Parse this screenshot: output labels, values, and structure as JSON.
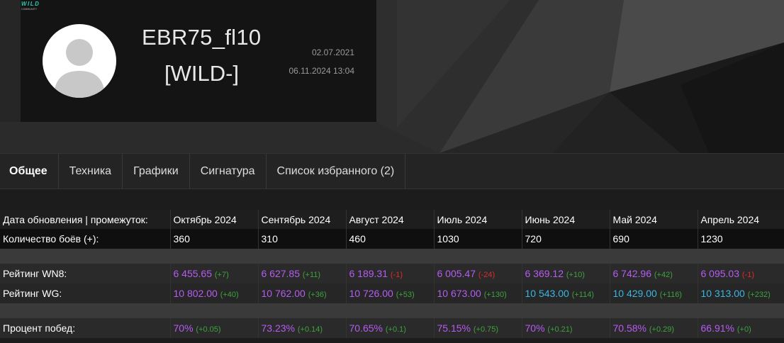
{
  "profile": {
    "nickname": "EBR75_fl10",
    "clan_tag": "[WILD-]",
    "clan_logo_text": "WILD",
    "clan_logo_sub": "COMMUNITY",
    "date_registered": "02.07.2021",
    "date_last_battle": "06.11.2024 13:04"
  },
  "tabs": [
    {
      "label": "Общее",
      "active": true
    },
    {
      "label": "Техника"
    },
    {
      "label": "Графики"
    },
    {
      "label": "Сигнатура"
    },
    {
      "label": "Список избранного (2)"
    }
  ],
  "table": {
    "header_label": "Дата обновления | промежуток:",
    "months": [
      "Октябрь 2024",
      "Сентябрь 2024",
      "Август 2024",
      "Июль 2024",
      "Июнь 2024",
      "Май 2024",
      "Апрель 2024"
    ],
    "battles_label": "Количество боёв (+):",
    "battles": [
      "360",
      "310",
      "460",
      "1030",
      "720",
      "690",
      "1230"
    ],
    "wn8_label": "Рейтинг WN8:",
    "wn8": [
      {
        "value": "6 455.65",
        "delta": "(+7)",
        "trend": "up",
        "tone": "purple"
      },
      {
        "value": "6 627.85",
        "delta": "(+11)",
        "trend": "up",
        "tone": "purple"
      },
      {
        "value": "6 189.31",
        "delta": "(-1)",
        "trend": "down",
        "tone": "purple"
      },
      {
        "value": "6 005.47",
        "delta": "(-24)",
        "trend": "down",
        "tone": "purple"
      },
      {
        "value": "6 369.12",
        "delta": "(+10)",
        "trend": "up",
        "tone": "purple"
      },
      {
        "value": "6 742.96",
        "delta": "(+42)",
        "trend": "up",
        "tone": "purple"
      },
      {
        "value": "6 095.03",
        "delta": "(-1)",
        "trend": "down",
        "tone": "purple"
      }
    ],
    "wg_label": "Рейтинг WG:",
    "wg": [
      {
        "value": "10 802.00",
        "delta": "(+40)",
        "trend": "up",
        "tone": "purple"
      },
      {
        "value": "10 762.00",
        "delta": "(+36)",
        "trend": "up",
        "tone": "purple"
      },
      {
        "value": "10 726.00",
        "delta": "(+53)",
        "trend": "up",
        "tone": "purple"
      },
      {
        "value": "10 673.00",
        "delta": "(+130)",
        "trend": "up",
        "tone": "purple"
      },
      {
        "value": "10 543.00",
        "delta": "(+114)",
        "trend": "up",
        "tone": "cyan"
      },
      {
        "value": "10 429.00",
        "delta": "(+116)",
        "trend": "up",
        "tone": "cyan"
      },
      {
        "value": "10 313.00",
        "delta": "(+232)",
        "trend": "up",
        "tone": "cyan"
      }
    ],
    "winrate_label": "Процент побед:",
    "winrate": [
      {
        "value": "70%",
        "delta": "(+0.05)",
        "trend": "up",
        "tone": "purple"
      },
      {
        "value": "73.23%",
        "delta": "(+0.14)",
        "trend": "up",
        "tone": "purple"
      },
      {
        "value": "70.65%",
        "delta": "(+0.1)",
        "trend": "up",
        "tone": "purple"
      },
      {
        "value": "75.15%",
        "delta": "(+0.75)",
        "trend": "up",
        "tone": "purple"
      },
      {
        "value": "70%",
        "delta": "(+0.21)",
        "trend": "up",
        "tone": "purple"
      },
      {
        "value": "70.58%",
        "delta": "(+0.29)",
        "trend": "up",
        "tone": "purple"
      },
      {
        "value": "66.91%",
        "delta": "(+0)",
        "trend": "up",
        "tone": "purple"
      }
    ]
  },
  "colors": {
    "purple": "#b65cf2",
    "cyan": "#3bb6e0",
    "green": "#3da33d",
    "red": "#e02b2b"
  }
}
